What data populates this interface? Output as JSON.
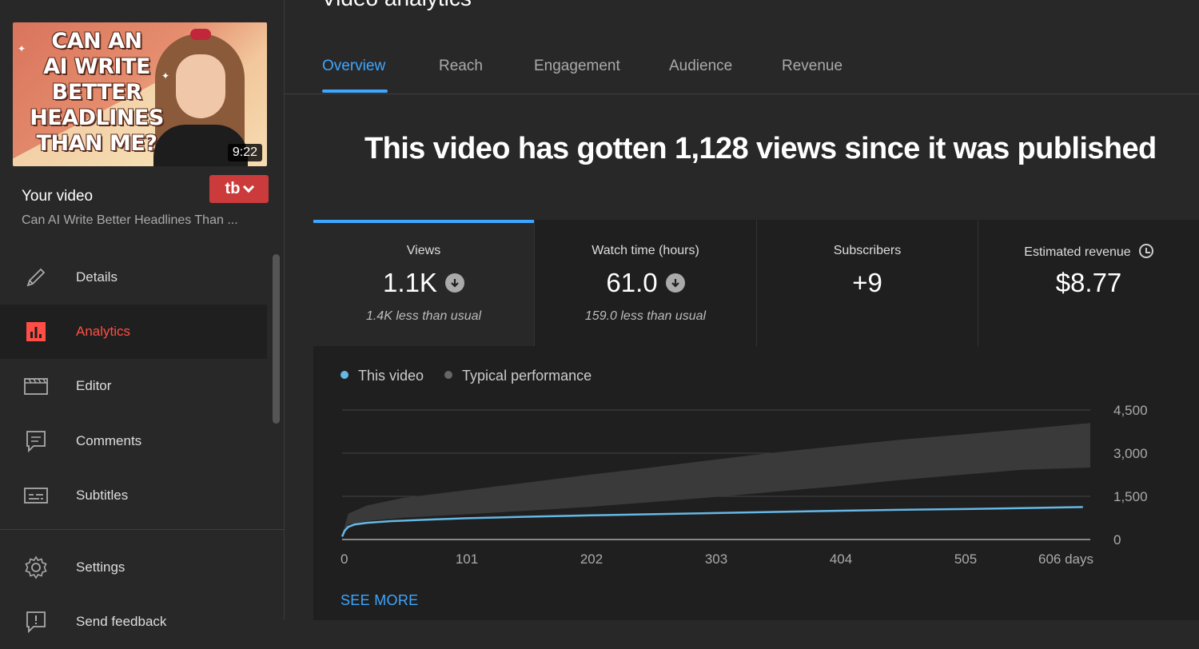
{
  "sidebar": {
    "thumbnail": {
      "headline_lines": [
        "CAN AN",
        "AI WRITE",
        "BETTER",
        "HEADLINES",
        "THAN ME?"
      ],
      "duration": "9:22"
    },
    "tb_label": "tb",
    "your_video_label": "Your video",
    "video_title": "Can AI Write Better Headlines Than ...",
    "items": [
      {
        "label": "Details",
        "icon": "pencil-icon"
      },
      {
        "label": "Analytics",
        "icon": "analytics-icon"
      },
      {
        "label": "Editor",
        "icon": "clapperboard-icon"
      },
      {
        "label": "Comments",
        "icon": "comment-icon"
      },
      {
        "label": "Subtitles",
        "icon": "subtitles-icon"
      },
      {
        "label": "Settings",
        "icon": "gear-icon"
      },
      {
        "label": "Send feedback",
        "icon": "feedback-icon"
      }
    ]
  },
  "page_title": "Video analytics",
  "tabs": [
    {
      "label": "Overview"
    },
    {
      "label": "Reach"
    },
    {
      "label": "Engagement"
    },
    {
      "label": "Audience"
    },
    {
      "label": "Revenue"
    }
  ],
  "headline": "This video has gotten 1,128 views since it was published",
  "metrics": [
    {
      "name": "Views",
      "value": "1.1K",
      "note": "1.4K less than usual"
    },
    {
      "name": "Watch time (hours)",
      "value": "61.0",
      "note": "159.0 less than usual"
    },
    {
      "name": "Subscribers",
      "value": "+9",
      "note": ""
    },
    {
      "name": "Estimated revenue",
      "value": "$8.77",
      "note": ""
    }
  ],
  "legend": {
    "this_video": "This video",
    "typical": "Typical performance"
  },
  "see_more": "SEE MORE",
  "colors": {
    "accent": "#3ea6ff",
    "active_nav": "#ff4e45",
    "this_video_line": "#65b8e6",
    "typical_band": "#3a3a3a"
  },
  "chart_data": {
    "type": "line",
    "x_ticks": [
      "0",
      "101",
      "202",
      "303",
      "404",
      "505",
      "606 days"
    ],
    "y_ticks": [
      "0",
      "1,500",
      "3,000",
      "4,500"
    ],
    "xlim": [
      0,
      606
    ],
    "ylim": [
      0,
      4500
    ],
    "this_video": {
      "name": "This video",
      "x": [
        0,
        2,
        5,
        10,
        20,
        40,
        70,
        101,
        150,
        202,
        250,
        303,
        350,
        404,
        450,
        505,
        550,
        600
      ],
      "y": [
        100,
        300,
        440,
        520,
        580,
        640,
        690,
        740,
        790,
        840,
        880,
        920,
        960,
        1000,
        1030,
        1060,
        1090,
        1128
      ]
    },
    "typical": {
      "name": "Typical performance",
      "x": [
        0,
        5,
        20,
        50,
        101,
        150,
        202,
        250,
        303,
        350,
        404,
        450,
        505,
        550,
        606
      ],
      "low": [
        100,
        520,
        640,
        760,
        880,
        1000,
        1140,
        1300,
        1480,
        1660,
        1860,
        2060,
        2260,
        2420,
        2500
      ],
      "high": [
        150,
        900,
        1180,
        1450,
        1720,
        1980,
        2260,
        2500,
        2780,
        3020,
        3260,
        3460,
        3660,
        3830,
        4050
      ]
    }
  }
}
